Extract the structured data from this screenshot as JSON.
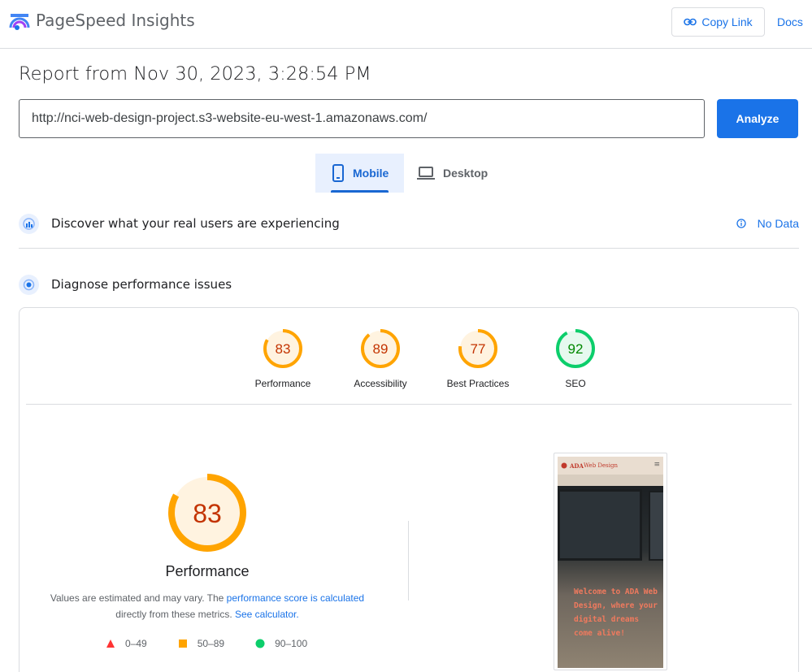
{
  "app": {
    "title": "PageSpeed Insights"
  },
  "header": {
    "copy_link": "Copy Link",
    "docs": "Docs"
  },
  "report": {
    "title": "Report from Nov 30, 2023, 3:28:54 PM"
  },
  "url_field": {
    "value": "http://nci-web-design-project.s3-website-eu-west-1.amazonaws.com/"
  },
  "analyze": {
    "label": "Analyze"
  },
  "tabs": [
    {
      "label": "Mobile",
      "icon": "phone-icon",
      "selected": true
    },
    {
      "label": "Desktop",
      "icon": "laptop-icon",
      "selected": false
    }
  ],
  "real_users": {
    "label": "Discover what your real users are experiencing",
    "status": "No Data"
  },
  "diagnose": {
    "label": "Diagnose performance issues"
  },
  "scores": [
    {
      "label": "Performance",
      "value": 83,
      "color": "#ffa400",
      "bg": "#fff3e0",
      "text_color": "#c33300"
    },
    {
      "label": "Accessibility",
      "value": 89,
      "color": "#ffa400",
      "bg": "#fff3e0",
      "text_color": "#c33300"
    },
    {
      "label": "Best Practices",
      "value": 77,
      "color": "#ffa400",
      "bg": "#fff3e0",
      "text_color": "#c33300"
    },
    {
      "label": "SEO",
      "value": 92,
      "color": "#0cce6b",
      "bg": "#e6f9ef",
      "text_color": "#008800"
    }
  ],
  "performance": {
    "score": 83,
    "title": "Performance",
    "note_prefix": "Values are estimated and may vary. The ",
    "note_link1": "performance score is calculated",
    "note_middle": " directly from these metrics. ",
    "note_link2": "See calculator.",
    "legend": [
      {
        "range": "0–49",
        "shape": "triangle",
        "color": "#ff3333"
      },
      {
        "range": "50–89",
        "shape": "square",
        "color": "#ffa400"
      },
      {
        "range": "90–100",
        "shape": "circle",
        "color": "#0cce6b"
      }
    ]
  },
  "screenshot": {
    "brand_a": "ADA",
    "brand_b": " Web Design",
    "hero_text": "Welcome to ADA Web Design, where your digital dreams come alive!"
  }
}
